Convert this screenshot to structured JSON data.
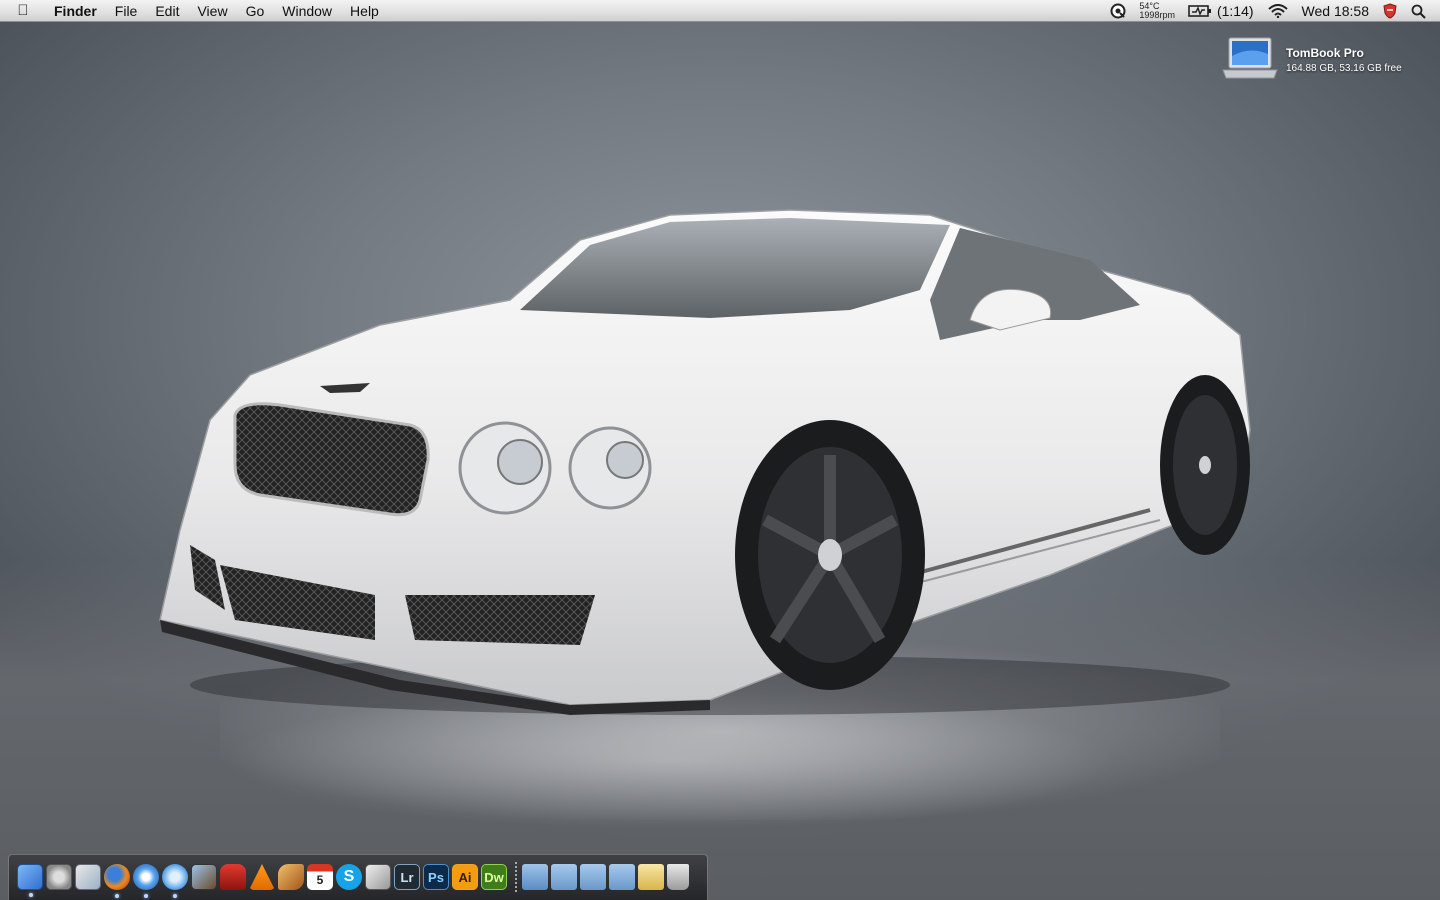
{
  "menubar": {
    "app_name": "Finder",
    "menus": [
      "File",
      "Edit",
      "View",
      "Go",
      "Window",
      "Help"
    ],
    "status": {
      "temperature": "54°C",
      "fan_speed": "1998rpm",
      "battery_time": "(1:14)",
      "clock": "Wed 18:58"
    }
  },
  "desktop": {
    "drive": {
      "name": "TomBook Pro",
      "info": "164.88 GB, 53.16 GB free"
    }
  },
  "dock": {
    "apps": [
      {
        "name": "Finder",
        "icon": "finder-icon",
        "running": true
      },
      {
        "name": "System Preferences",
        "icon": "system-preferences-icon",
        "running": false
      },
      {
        "name": "Photo app",
        "icon": "photo-icon",
        "running": false
      },
      {
        "name": "Firefox",
        "icon": "firefox-icon",
        "running": true
      },
      {
        "name": "Safari",
        "icon": "safari-icon",
        "running": true
      },
      {
        "name": "iTunes",
        "icon": "itunes-icon",
        "running": true
      },
      {
        "name": "iPhoto",
        "icon": "iphoto-icon",
        "running": false
      },
      {
        "name": "Front Row",
        "icon": "chair-icon",
        "running": false
      },
      {
        "name": "VLC",
        "icon": "vlc-icon",
        "running": false
      },
      {
        "name": "GarageBand",
        "icon": "guitar-icon",
        "running": false
      },
      {
        "name": "iCal",
        "icon": "calendar-icon",
        "running": false,
        "label": "5"
      },
      {
        "name": "Skype",
        "icon": "skype-icon",
        "running": false,
        "label": "S"
      },
      {
        "name": "Script app",
        "icon": "script-icon",
        "running": false
      },
      {
        "name": "Lightroom",
        "icon": "lightroom-icon",
        "running": false,
        "label": "Lr"
      },
      {
        "name": "Photoshop",
        "icon": "photoshop-icon",
        "running": false,
        "label": "Ps"
      },
      {
        "name": "Illustrator",
        "icon": "illustrator-icon",
        "running": false,
        "label": "Ai"
      },
      {
        "name": "Dreamweaver",
        "icon": "dreamweaver-icon",
        "running": false,
        "label": "Dw"
      }
    ],
    "stacks": [
      {
        "icon": "applications-folder-icon"
      },
      {
        "icon": "documents-folder-icon"
      },
      {
        "icon": "folder-icon"
      },
      {
        "icon": "folder-icon"
      },
      {
        "icon": "open-folder-icon"
      },
      {
        "icon": "trash-icon"
      }
    ]
  }
}
